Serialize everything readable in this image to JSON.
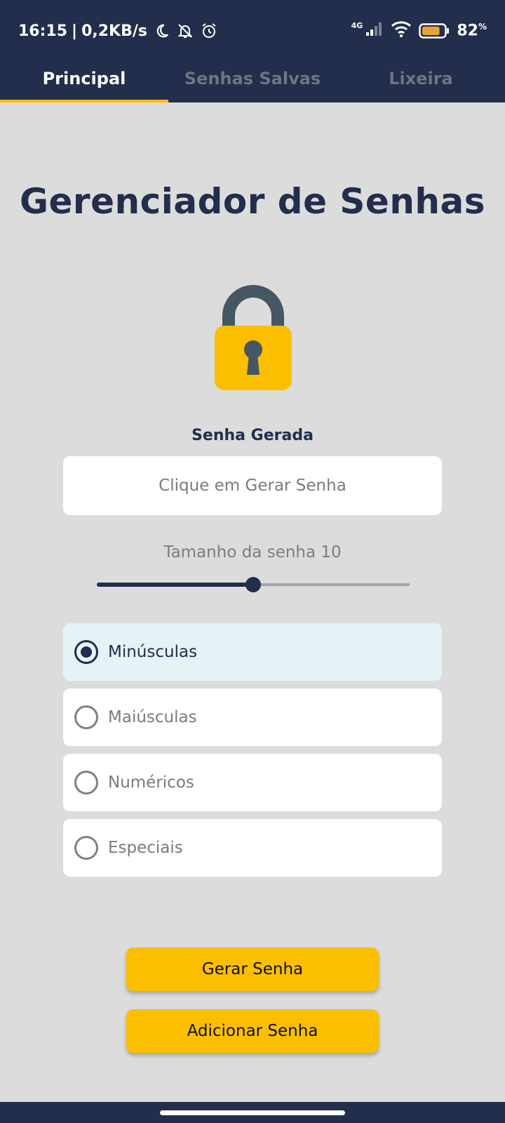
{
  "status_bar": {
    "time": "16:15",
    "separator": "|",
    "net_speed": "0,2KB/s",
    "network_type": "4G",
    "battery_percent": "82",
    "battery_unit": "%",
    "battery_level": 0.82,
    "icons": [
      "moon-icon",
      "bell-off-icon",
      "alarm-icon",
      "signal-icon",
      "wifi-icon",
      "battery-icon"
    ]
  },
  "tabs": [
    {
      "label": "Principal",
      "active": true
    },
    {
      "label": "Senhas Salvas",
      "active": false
    },
    {
      "label": "Lixeira",
      "active": false
    }
  ],
  "main": {
    "title": "Gerenciador de Senhas",
    "icon": "lock-icon",
    "generated_label": "Senha Gerada",
    "password_placeholder": "Clique em Gerar Senha",
    "length_label": "Tamanho da senha 10",
    "slider_level": 0.5,
    "options": [
      {
        "label": "Minúsculas",
        "selected": true
      },
      {
        "label": "Maiúsculas",
        "selected": false
      },
      {
        "label": "Numéricos",
        "selected": false
      },
      {
        "label": "Especiais",
        "selected": false
      }
    ],
    "generate_button": "Gerar Senha",
    "add_button": "Adicionar Senha"
  },
  "colors": {
    "primary": "#222e4b",
    "accent": "#fbbf00",
    "background": "#dcdcdc",
    "selected_option": "#e6f2f6"
  }
}
